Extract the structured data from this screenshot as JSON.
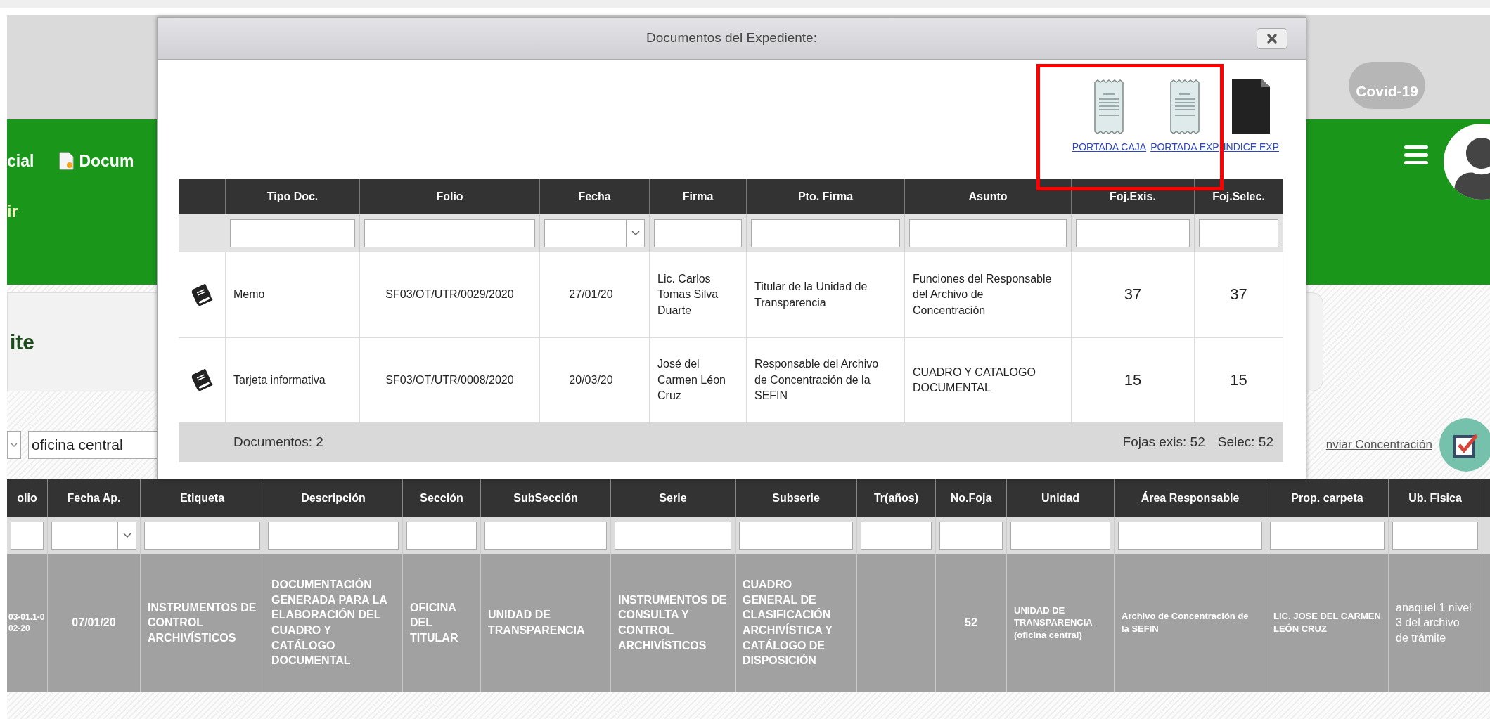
{
  "header": {
    "badge": "Covid-19"
  },
  "nav": {
    "items": [
      {
        "label": "cial",
        "kind": "text"
      },
      {
        "label": "Docum",
        "kind": "document"
      }
    ],
    "second_row": "ir"
  },
  "page": {
    "title": "ite"
  },
  "filter_bar": {
    "office_field": {
      "value": "oficina central"
    },
    "link": "nviar Concentración"
  },
  "table": {
    "columns": [
      {
        "label": "olio",
        "kind": "text"
      },
      {
        "label": "Fecha Ap.",
        "kind": "select"
      },
      {
        "label": "Etiqueta",
        "kind": "text"
      },
      {
        "label": "Descripción",
        "kind": "text"
      },
      {
        "label": "Sección",
        "kind": "text"
      },
      {
        "label": "SubSección",
        "kind": "text"
      },
      {
        "label": "Serie",
        "kind": "text"
      },
      {
        "label": "Subserie",
        "kind": "text"
      },
      {
        "label": "Tr(años)",
        "kind": "text"
      },
      {
        "label": "No.Foja",
        "kind": "text"
      },
      {
        "label": "Unidad",
        "kind": "text"
      },
      {
        "label": "Área Responsable",
        "kind": "text"
      },
      {
        "label": "Prop. carpeta",
        "kind": "text"
      },
      {
        "label": "Ub. Fisica",
        "kind": "text"
      }
    ],
    "rows": [
      {
        "cells": [
          "03-01.1-002-20",
          "07/01/20",
          "INSTRUMENTOS DE CONTROL ARCHIVÍSTICOS",
          "DOCUMENTACIÓN GENERADA PARA LA ELABORACIÓN DEL CUADRO Y CATÁLOGO DOCUMENTAL",
          "OFICINA DEL TITULAR",
          "UNIDAD DE TRANSPARENCIA",
          "INSTRUMENTOS DE CONSULTA Y CONTROL ARCHIVÍSTICOS",
          "CUADRO GENERAL DE CLASIFICACIÓN ARCHIVÍSTICA Y CATÁLOGO DE DISPOSICIÓN",
          null,
          "52",
          "UNIDAD DE TRANSPARENCIA (oficina central)",
          "Archivo de Concentración de la SEFIN",
          "LIC. JOSE DEL CARMEN LEÓN CRUZ",
          "anaquel 1 nivel 3 del archivo de trámite"
        ]
      }
    ]
  },
  "modal": {
    "title": "Documentos del Expediente:",
    "links": [
      {
        "label": "PORTADA CAJA",
        "kind": "receipt"
      },
      {
        "label": "PORTADA EXP",
        "kind": "receipt"
      },
      {
        "label": "INDICE EXP",
        "kind": "document"
      }
    ],
    "table": {
      "columns": [
        {
          "label": "Tipo Doc.",
          "kind": "text"
        },
        {
          "label": "Folio",
          "kind": "text"
        },
        {
          "label": "Fecha",
          "kind": "select"
        },
        {
          "label": "Firma",
          "kind": "text"
        },
        {
          "label": "Pto. Firma",
          "kind": "text"
        },
        {
          "label": "Asunto",
          "kind": "text"
        },
        {
          "label": "Foj.Exis.",
          "kind": "text"
        },
        {
          "label": "Foj.Selec.",
          "kind": "text"
        }
      ],
      "rows": [
        {
          "kind": "book",
          "cells": [
            "Memo",
            "SF03/OT/UTR/0029/2020",
            "27/01/20",
            "Lic. Carlos Tomas Silva Duarte",
            "Titular de la Unidad de Transparencia",
            "Funciones del Responsable del Archivo de Concentración",
            "37",
            "37"
          ]
        },
        {
          "kind": "book",
          "cells": [
            "Tarjeta informativa",
            "SF03/OT/UTR/0008/2020",
            "20/03/20",
            "José del Carmen Léon Cruz",
            "Responsable del Archivo de Concentración de la SEFIN",
            "CUADRO Y CATALOGO DOCUMENTAL",
            "15",
            "15"
          ]
        }
      ]
    },
    "footer": {
      "count": "Documentos: 2",
      "existing": "Fojas exis: 52",
      "selected": "Selec: 52"
    }
  }
}
